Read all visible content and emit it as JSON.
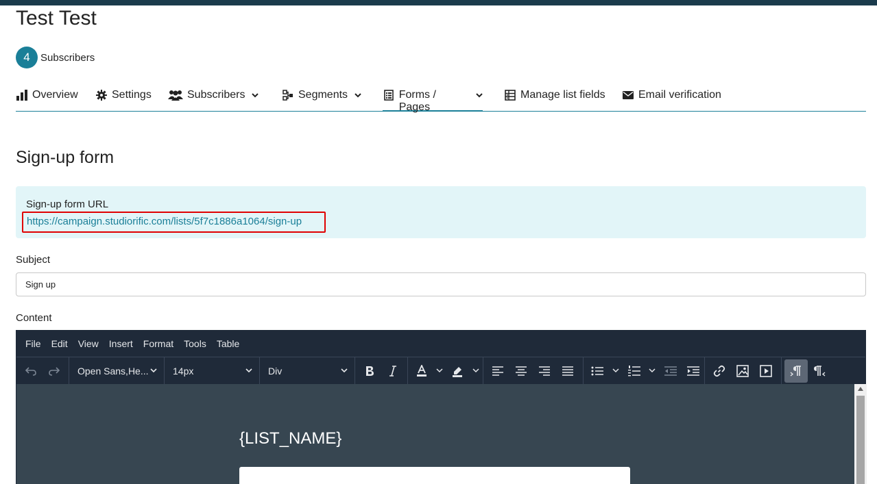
{
  "page": {
    "title": "Test Test",
    "subscriber_count": "4",
    "subscriber_label": "Subscribers"
  },
  "tabs": [
    {
      "label": "Overview",
      "icon": "bar-chart-icon"
    },
    {
      "label": "Settings",
      "icon": "gear-icon"
    },
    {
      "label": "Subscribers",
      "icon": "users-icon",
      "dropdown": true
    },
    {
      "label": "Segments",
      "icon": "segments-icon",
      "dropdown": true
    },
    {
      "label": "Forms / Pages",
      "icon": "forms-icon",
      "dropdown": true,
      "active": true
    },
    {
      "label": "Manage list fields",
      "icon": "table-icon"
    },
    {
      "label": "Email verification",
      "icon": "envelope-icon"
    }
  ],
  "section": {
    "title": "Sign-up form",
    "url_label": "Sign-up form URL",
    "url": "https://campaign.studiorific.com/lists/5f7c1886a1064/sign-up"
  },
  "subject": {
    "label": "Subject",
    "value": "Sign up"
  },
  "content": {
    "label": "Content",
    "menu": [
      "File",
      "Edit",
      "View",
      "Insert",
      "Format",
      "Tools",
      "Table"
    ],
    "font_family": "Open Sans,He...",
    "font_size": "14px",
    "block_format": "Div",
    "body_heading": "{LIST_NAME}"
  },
  "colors": {
    "accent": "#1a7f98",
    "topbar": "#1b3b4c",
    "info_bg": "#e2f5f8",
    "highlight_border": "#e00000",
    "editor_chrome": "#1f2a39",
    "editor_canvas": "#374651"
  }
}
